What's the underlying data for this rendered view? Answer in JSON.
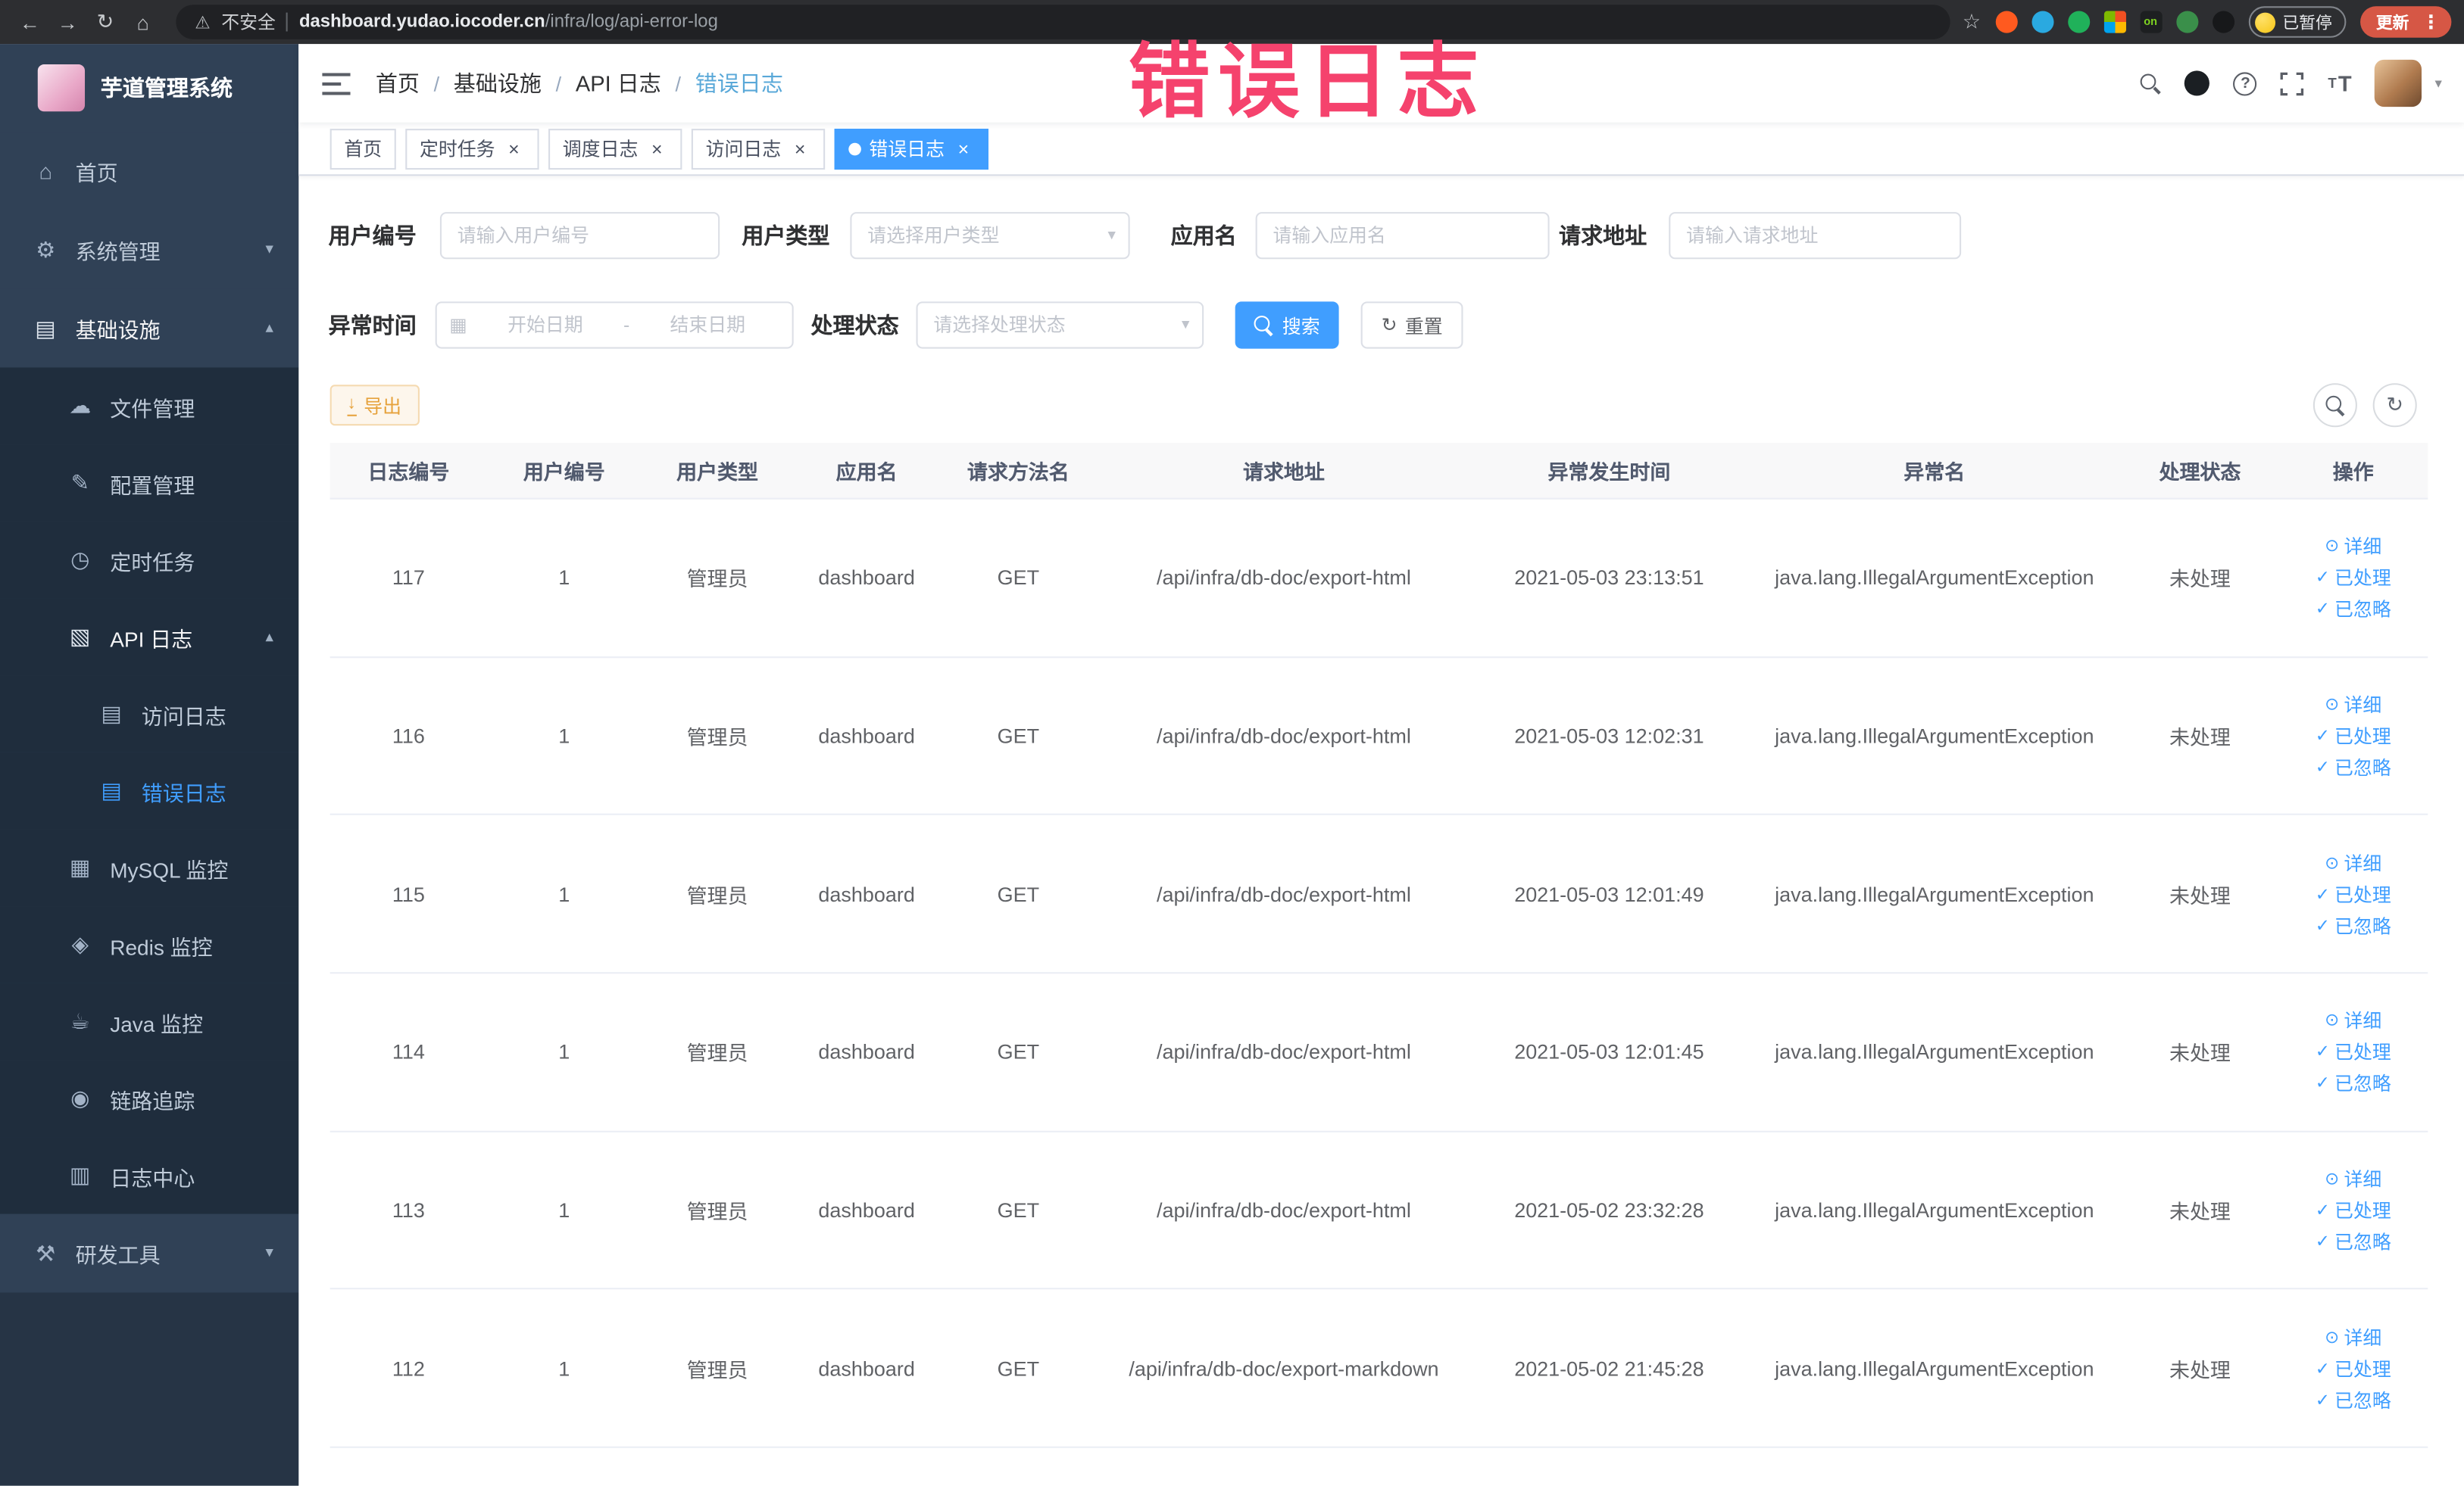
{
  "annotation": {
    "overlay_text": "错误日志"
  },
  "browser": {
    "security_label": "不安全",
    "url_host": "dashboard.yudao.iocoder.cn",
    "url_path": "/infra/log/api-error-log",
    "extensions_on_label": "on",
    "paused_badge": "已暂停",
    "update_button": "更新"
  },
  "sidebar": {
    "logo_title": "芋道管理系统",
    "items": [
      {
        "label": "首页",
        "icon": "home-icon",
        "depth": 1
      },
      {
        "label": "系统管理",
        "icon": "gear-icon",
        "depth": 1,
        "arrow": "down"
      },
      {
        "label": "基础设施",
        "icon": "infra-icon",
        "depth": 1,
        "arrow": "up",
        "parent_active": true
      },
      {
        "label": "文件管理",
        "icon": "file-icon",
        "depth": 2
      },
      {
        "label": "配置管理",
        "icon": "config-icon",
        "depth": 2
      },
      {
        "label": "定时任务",
        "icon": "task-icon",
        "depth": 2
      },
      {
        "label": "API 日志",
        "icon": "api-log-icon",
        "depth": 2,
        "arrow": "up",
        "parent_active": true
      },
      {
        "label": "访问日志",
        "icon": "access-log-icon",
        "depth": 3
      },
      {
        "label": "错误日志",
        "icon": "error-log-icon",
        "depth": 3,
        "active": true
      },
      {
        "label": "MySQL 监控",
        "icon": "mysql-icon",
        "depth": 2
      },
      {
        "label": "Redis 监控",
        "icon": "redis-icon",
        "depth": 2
      },
      {
        "label": "Java 监控",
        "icon": "java-icon",
        "depth": 2
      },
      {
        "label": "链路追踪",
        "icon": "trace-icon",
        "depth": 2
      },
      {
        "label": "日志中心",
        "icon": "log-center-icon",
        "depth": 2
      },
      {
        "label": "研发工具",
        "icon": "tools-icon",
        "depth": 1,
        "arrow": "down"
      }
    ]
  },
  "header": {
    "breadcrumb": [
      "首页",
      "基础设施",
      "API 日志",
      "错误日志"
    ]
  },
  "tabs": [
    {
      "label": "首页",
      "closable": false,
      "active": false
    },
    {
      "label": "定时任务",
      "closable": true,
      "active": false
    },
    {
      "label": "调度日志",
      "closable": true,
      "active": false
    },
    {
      "label": "访问日志",
      "closable": true,
      "active": false
    },
    {
      "label": "错误日志",
      "closable": true,
      "active": true
    }
  ],
  "filters": {
    "user_id": {
      "label": "用户编号",
      "placeholder": "请输入用户编号"
    },
    "user_type": {
      "label": "用户类型",
      "placeholder": "请选择用户类型"
    },
    "app_name": {
      "label": "应用名",
      "placeholder": "请输入应用名"
    },
    "request_url": {
      "label": "请求地址",
      "placeholder": "请输入请求地址"
    },
    "exception_time": {
      "label": "异常时间",
      "start_placeholder": "开始日期",
      "separator": "-",
      "end_placeholder": "结束日期"
    },
    "process_status": {
      "label": "处理状态",
      "placeholder": "请选择处理状态"
    },
    "search_button": "搜索",
    "reset_button": "重置"
  },
  "toolbar": {
    "export_button": "导出"
  },
  "table": {
    "headers": [
      "日志编号",
      "用户编号",
      "用户类型",
      "应用名",
      "请求方法名",
      "请求地址",
      "异常发生时间",
      "异常名",
      "处理状态",
      "操作"
    ],
    "action_labels": {
      "detail": "详细",
      "processed": "已处理",
      "ignored": "已忽略"
    },
    "rows": [
      {
        "cells": [
          "117",
          "1",
          "管理员",
          "dashboard",
          "GET",
          "/api/infra/db-doc/export-html",
          "2021-05-03 23:13:51",
          "java.lang.IllegalArgumentException",
          "未处理"
        ]
      },
      {
        "cells": [
          "116",
          "1",
          "管理员",
          "dashboard",
          "GET",
          "/api/infra/db-doc/export-html",
          "2021-05-03 12:02:31",
          "java.lang.IllegalArgumentException",
          "未处理"
        ]
      },
      {
        "cells": [
          "115",
          "1",
          "管理员",
          "dashboard",
          "GET",
          "/api/infra/db-doc/export-html",
          "2021-05-03 12:01:49",
          "java.lang.IllegalArgumentException",
          "未处理"
        ]
      },
      {
        "cells": [
          "114",
          "1",
          "管理员",
          "dashboard",
          "GET",
          "/api/infra/db-doc/export-html",
          "2021-05-03 12:01:45",
          "java.lang.IllegalArgumentException",
          "未处理"
        ]
      },
      {
        "cells": [
          "113",
          "1",
          "管理员",
          "dashboard",
          "GET",
          "/api/infra/db-doc/export-html",
          "2021-05-02 23:32:28",
          "java.lang.IllegalArgumentException",
          "未处理"
        ]
      },
      {
        "cells": [
          "112",
          "1",
          "管理员",
          "dashboard",
          "GET",
          "/api/infra/db-doc/export-markdown",
          "2021-05-02 21:45:28",
          "java.lang.IllegalArgumentException",
          "未处理"
        ]
      }
    ]
  },
  "colors": {
    "accent": "#409eff",
    "active_tab_bg": "#409eff",
    "warning_text": "#e6a23c",
    "annotation_color": "#f5426d",
    "sidebar_bg": "#304156",
    "submenu_bg": "#1f2d3d"
  }
}
